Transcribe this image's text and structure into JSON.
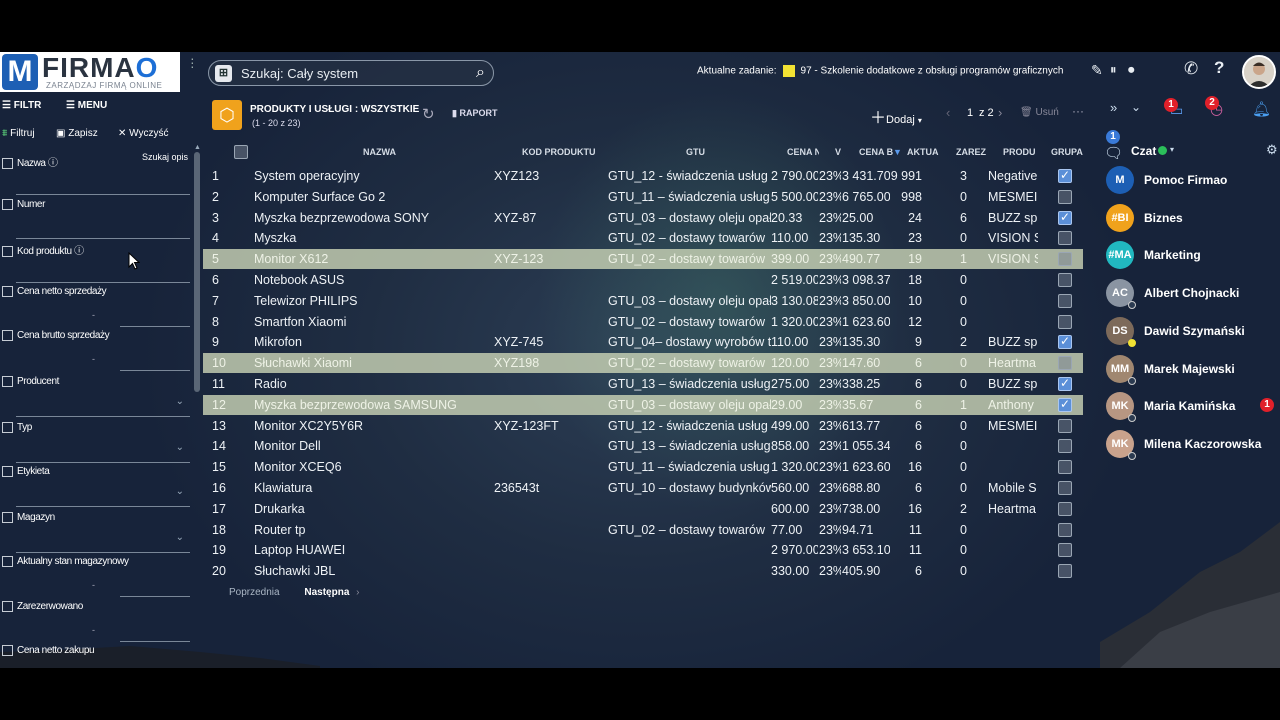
{
  "logo": {
    "text_main": "FIRMA",
    "text_accent": "O",
    "tagline": "ZARZĄDZAJ FIRMĄ ONLINE"
  },
  "search": {
    "placeholder": "Szukaj: Cały system"
  },
  "task": {
    "label": "Aktualne zadanie:",
    "value": "97 - Szkolenie dodatkowe z obsługi programów graficznych",
    "color": "#f2e233"
  },
  "left": {
    "filter_label": "FILTR",
    "menu_label": "MENU",
    "filtruj": "Filtruj",
    "zapisz": "Zapisz",
    "wyczysc": "Wyczyść",
    "szukaj_opis": "Szukaj opis",
    "fields": [
      "Nazwa",
      "Numer",
      "Kod produktu",
      "Cena netto sprzedaży",
      "Cena brutto sprzedaży",
      "Producent",
      "Typ",
      "Etykieta",
      "Magazyn",
      "Aktualny stan magazynowy",
      "Zarezerwowano",
      "Cena netto zakupu"
    ],
    "dash": "-"
  },
  "main": {
    "title": "PRODUKTY I USŁUGI : WSZYSTKIE",
    "subtitle": "(1 - 20 z 23)",
    "raport": "RAPORT",
    "dodaj": "Dodaj",
    "page": "1",
    "of_pages": "z 2",
    "usun": "Usuń"
  },
  "table": {
    "headers": [
      "NAZWA",
      "KOD PRODUKTU",
      "GTU",
      "CENA N",
      "V",
      "CENA B",
      "AKTUA",
      "ZAREZ",
      "PRODU",
      "GRUPA"
    ],
    "rows": [
      [
        "1",
        "System operacyjny",
        "XYZ123",
        "GTU_12 - świadczenia usług d",
        "2 790.00",
        "23%",
        "3 431.70",
        "9 991",
        "3",
        "Negative",
        true,
        false
      ],
      [
        "2",
        "Komputer Surface Go 2",
        "",
        "GTU_11 – świadczenia usług",
        "5 500.00",
        "23%",
        "6 765.00",
        "998",
        "0",
        "MESMEI",
        false,
        false
      ],
      [
        "3",
        "Myszka bezprzewodowa SONY",
        "XYZ-87",
        "GTU_03 – dostawy oleju opał",
        "20.33",
        "23%",
        "25.00",
        "24",
        "6",
        "BUZZ sp",
        true,
        false
      ],
      [
        "4",
        "Myszka",
        "",
        "GTU_02 – dostawy towarów",
        "110.00",
        "23%",
        "135.30",
        "23",
        "0",
        "VISION S",
        false,
        false
      ],
      [
        "5",
        "Monitor X612",
        "XYZ-123",
        "GTU_02 – dostawy towarów",
        "399.00",
        "23%",
        "490.77",
        "19",
        "1",
        "VISION S",
        false,
        true
      ],
      [
        "6",
        "Notebook ASUS",
        "",
        "",
        "2 519.00",
        "23%",
        "3 098.37",
        "18",
        "0",
        "",
        false,
        false
      ],
      [
        "7",
        "Telewizor PHILIPS",
        "",
        "GTU_03 – dostawy oleju opał",
        "3 130.08",
        "23%",
        "3 850.00",
        "10",
        "0",
        "",
        false,
        false
      ],
      [
        "8",
        "Smartfon Xiaomi",
        "",
        "GTU_02 – dostawy towarów",
        "1 320.00",
        "23%",
        "1 623.60",
        "12",
        "0",
        "",
        false,
        false
      ],
      [
        "9",
        "Mikrofon",
        "XYZ-745",
        "GTU_04– dostawy wyrobów t",
        "110.00",
        "23%",
        "135.30",
        "9",
        "2",
        "BUZZ sp",
        true,
        false
      ],
      [
        "10",
        "Słuchawki Xiaomi",
        "XYZ198",
        "GTU_02 – dostawy towarów",
        "120.00",
        "23%",
        "147.60",
        "6",
        "0",
        "Heartma",
        false,
        true
      ],
      [
        "11",
        "Radio",
        "",
        "GTU_13 – świadczenia usług",
        "275.00",
        "23%",
        "338.25",
        "6",
        "0",
        "BUZZ sp",
        true,
        false
      ],
      [
        "12",
        "Myszka bezprzewodowa SAMSUNG",
        "",
        "GTU_03 – dostawy oleju opał",
        "29.00",
        "23%",
        "35.67",
        "6",
        "1",
        "Anthony",
        true,
        true
      ],
      [
        "13",
        "Monitor XC2Y5Y6R",
        "XYZ-123FT",
        "GTU_12 - świadczenia usług",
        "499.00",
        "23%",
        "613.77",
        "6",
        "0",
        "MESMEI",
        false,
        false
      ],
      [
        "14",
        "Monitor Dell",
        "",
        "GTU_13 – świadczenia usług",
        "858.00",
        "23%",
        "1 055.34",
        "6",
        "0",
        "",
        false,
        false
      ],
      [
        "15",
        "Monitor XCEQ6",
        "",
        "GTU_11 – świadczenia usług",
        "1 320.00",
        "23%",
        "1 623.60",
        "16",
        "0",
        "",
        false,
        false
      ],
      [
        "16",
        "Klawiatura",
        "236543t",
        "GTU_10 – dostawy budynków",
        "560.00",
        "23%",
        "688.80",
        "6",
        "0",
        "Mobile S",
        false,
        false
      ],
      [
        "17",
        "Drukarka",
        "",
        "",
        "600.00",
        "23%",
        "738.00",
        "16",
        "2",
        "Heartma",
        false,
        false
      ],
      [
        "18",
        "Router tp",
        "",
        "GTU_02 – dostawy towarów",
        "77.00",
        "23%",
        "94.71",
        "11",
        "0",
        "",
        false,
        false
      ],
      [
        "19",
        "Laptop HUAWEI",
        "",
        "",
        "2 970.00",
        "23%",
        "3 653.10",
        "11",
        "0",
        "",
        false,
        false
      ],
      [
        "20",
        "Słuchawki JBL",
        "",
        "",
        "330.00",
        "23%",
        "405.90",
        "6",
        "0",
        "",
        false,
        false
      ]
    ]
  },
  "pager": {
    "prev": "Poprzednia",
    "next": "Następna"
  },
  "right": {
    "chat_label": "Czat",
    "chat_badge": "1",
    "notif_badge_1": "1",
    "notif_badge_2": "2",
    "contacts": [
      {
        "name": "Pomoc Firmao",
        "initials": "M",
        "color": "#1d5fb4"
      },
      {
        "name": "Biznes",
        "initials": "#BI",
        "color": "#f0a21c"
      },
      {
        "name": "Marketing",
        "initials": "#MA",
        "color": "#21b8c0"
      },
      {
        "name": "Albert Chojnacki",
        "initials": "AC",
        "color": "#8a94a2"
      },
      {
        "name": "Dawid Szymański",
        "initials": "DS",
        "color": "#7d6a5a"
      },
      {
        "name": "Marek Majewski",
        "initials": "MM",
        "color": "#a08770"
      },
      {
        "name": "Maria Kamińska",
        "initials": "MK",
        "color": "#b79682"
      },
      {
        "name": "Milena Kaczorowska",
        "initials": "MK",
        "color": "#c9a28c"
      }
    ],
    "maria_badge": "1"
  }
}
